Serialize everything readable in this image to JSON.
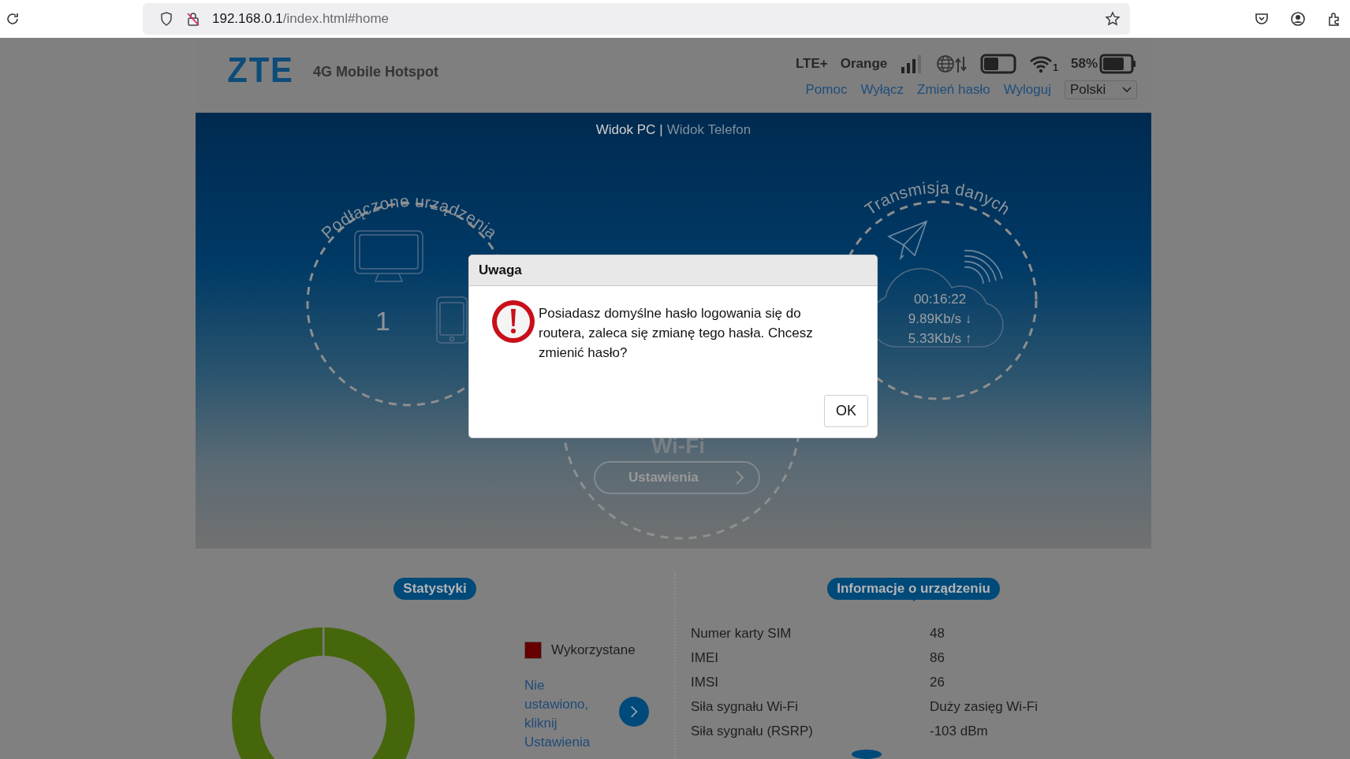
{
  "browser": {
    "url_host": "192.168.0.1",
    "url_path": "/index.html#home"
  },
  "header": {
    "logo": "ZTE",
    "product": "4G Mobile Hotspot",
    "network_type": "LTE+",
    "operator": "Orange",
    "wifi_clients": "1",
    "battery_percent": "58%",
    "links": [
      "Pomoc",
      "Wyłącz",
      "Zmień hasło",
      "Wyloguj"
    ],
    "language": "Polski"
  },
  "view_switch": {
    "options": [
      {
        "label": "Widok PC",
        "selected": true
      },
      {
        "label": "Widok Telefon",
        "selected": false
      }
    ],
    "separator": "|"
  },
  "connected_devices": {
    "title": "Podłączone urządzenia",
    "count": "1"
  },
  "data_transfer": {
    "title": "Transmisja danych",
    "time": "00:16:22",
    "download": "9.89Kb/s ↓",
    "upload": "5.33Kb/s ↑"
  },
  "wifi": {
    "title": "Wi-Fi",
    "button": "Ustawienia"
  },
  "statistics": {
    "title": "Statystyki",
    "legend": [
      {
        "label": "Wykorzystane",
        "color": "#660000"
      }
    ],
    "note": "Nie ustawiono, kliknij Ustawienia"
  },
  "device_info": {
    "title": "Informacje o urządzeniu",
    "rows": [
      {
        "label": "Numer karty SIM",
        "value": "48"
      },
      {
        "label": "IMEI",
        "value": "86"
      },
      {
        "label": "IMSI",
        "value": "26"
      },
      {
        "label": "Siła sygnału Wi-Fi",
        "value": "Duży zasięg Wi-Fi"
      },
      {
        "label": "Siła sygnału (RSRP)",
        "value": "-103 dBm"
      }
    ]
  },
  "dialog": {
    "title": "Uwaga",
    "message": "Posiadasz domyślne hasło logowania się do routera, zaleca się zmianę tego hasła. Chcesz zmienić hasło?",
    "button": "OK"
  }
}
